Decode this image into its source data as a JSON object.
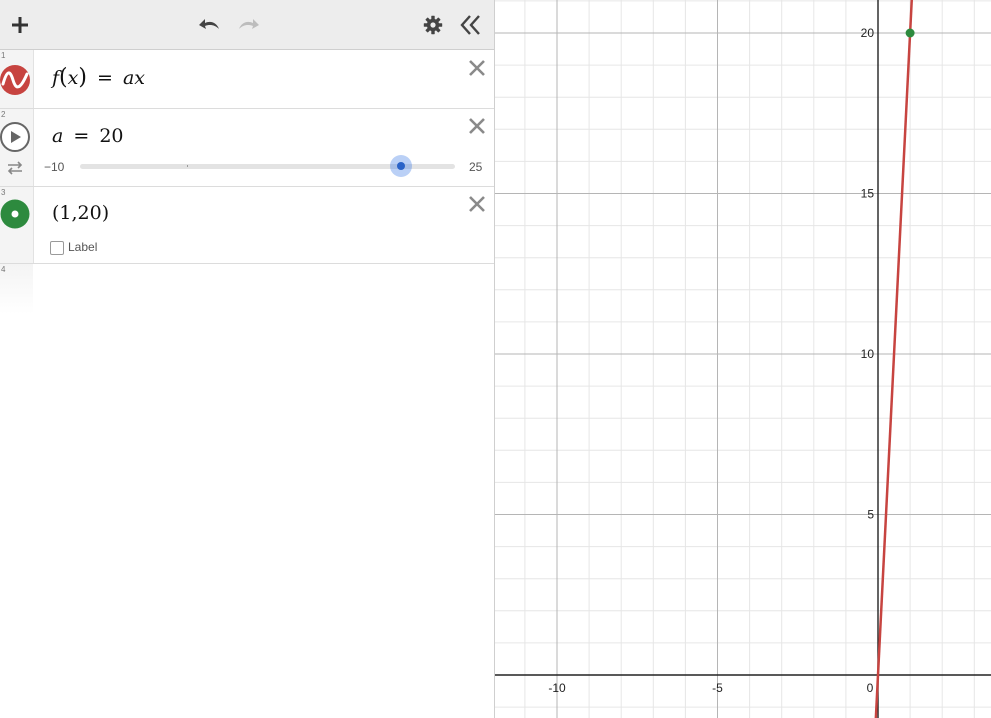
{
  "toolbar": {
    "add": "plus-icon",
    "undo": "undo-icon",
    "redo": "redo-icon",
    "settings": "gear-icon",
    "collapse": "double-chevron-left-icon"
  },
  "expressions": [
    {
      "index": "1",
      "icon": "function-wave-icon",
      "color": "#c74440",
      "latex": {
        "lhs_fn": "f",
        "lhs_arg": "x",
        "rhs": "ax"
      }
    },
    {
      "index": "2",
      "icon": "play-icon",
      "secondary_icon": "repeat-icon",
      "variable": "a",
      "value": "20",
      "slider": {
        "min": "−10",
        "max": "25",
        "min_value": -10,
        "max_value": 25,
        "value": 20
      }
    },
    {
      "index": "3",
      "icon": "point-icon",
      "color": "#2d8a3e",
      "point": "(1,20)",
      "label_checkbox": "Label",
      "label_checked": false
    },
    {
      "index": "4"
    }
  ],
  "graph": {
    "x_ticks": [
      "-10",
      "-5",
      "0"
    ],
    "y_ticks": [
      "5",
      "10",
      "15",
      "20"
    ],
    "line_color": "#c74440",
    "point_color": "#2d8a3e",
    "line_slope": 20,
    "point_x": 1,
    "point_y": 20
  }
}
